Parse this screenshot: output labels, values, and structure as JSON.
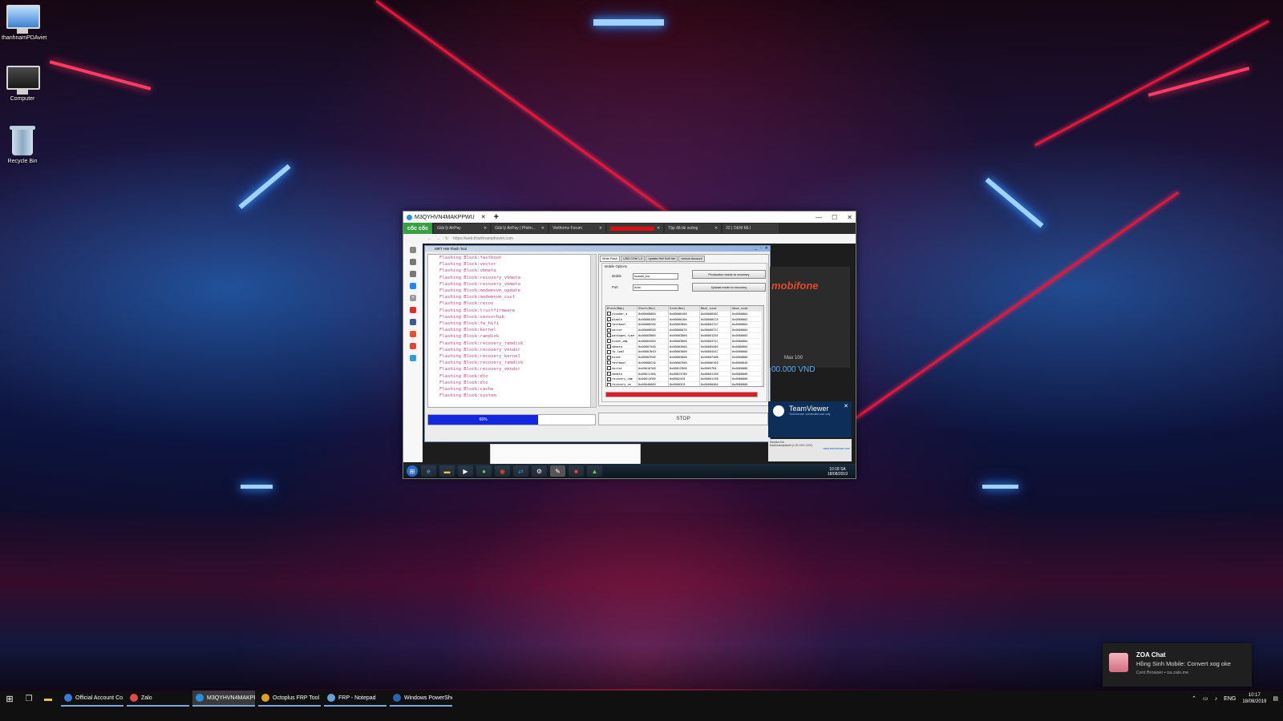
{
  "desktop": {
    "icons": [
      {
        "label": "thanhnamPDAviet"
      },
      {
        "label": "Computer"
      },
      {
        "label": "Recycle Bin"
      }
    ]
  },
  "remote_window": {
    "tab_title": "M3QYHVN4MAKPPWU",
    "tab_close": "✕",
    "new_tab": "+",
    "browser": {
      "brand": "cốc cốc",
      "tabs": [
        {
          "label": "Giải lý AirPay"
        },
        {
          "label": "Giải lý AirPay | Phiên..."
        },
        {
          "label": "Vietforms Forum"
        },
        {
          "label": ""
        },
        {
          "label": "Tập đã tải xuống"
        },
        {
          "label": "22 | OEM MLI"
        }
      ],
      "address": "https://web.thanhnamphoviet.com"
    },
    "mrt": {
      "title": "MRT HW Flash Tool",
      "log_lines": [
        "Flashing Block:fastboot",
        "Flashing Block:vector",
        "Flashing Block:vbmeta",
        "Flashing Block:recovery_vbmeta",
        "Flashing Block:recovery_vbmeta",
        "Flashing Block:modemnvm_update",
        "Flashing Block:modemnvm_cust",
        "Flashing Block:recov",
        "Flashing Block:trustfirmware",
        "Flashing Block:sensorhub",
        "Flashing Block:fw_hifi",
        "Flashing Block:kernel",
        "Flashing Block:ramdisk",
        "Flashing Block:recovery_ramdisk",
        "Flashing Block:recovery_vendor",
        "Flashing Block:recovery_kernel",
        "Flashing Block:recovery_ramdisk",
        "Flashing Block:recovery_vendor",
        "Flashing Block:dto",
        "Flashing Block:dto",
        "Flashing Block:cache",
        "Flashing Block:system"
      ],
      "panel_tabs": [
        "Write Flash",
        "USB COM 1.0",
        "Update HW Soft Ver",
        "Unlock Account"
      ],
      "group_title": "Mobile Options",
      "mobile_label": "Mobile",
      "mobile_value": "huawei_fus",
      "port_label": "Port",
      "port_value": "Auto",
      "btn_production": "Production mode to recovery",
      "btn_upload": "Upload mode to recovery",
      "grid_headers": [
        "Block(Map)",
        "Start(Hex)",
        "Size(Hex)",
        "Real_size",
        "Save_size"
      ],
      "grid_rows": [
        [
          "xloader_a",
          "0x00000000",
          "0x00000100",
          "0x0000030C",
          "0x0000004"
        ],
        [
          "ptable",
          "0x00000100",
          "0x0000010A",
          "0x00000CC0",
          "0x0000002"
        ],
        [
          "fastboot",
          "0x00000C00",
          "0x0000300A",
          "0x0000472C",
          "0x0000004"
        ],
        [
          "vector",
          "0x00000E00",
          "0x00000070",
          "0x0000072C",
          "0x0000004"
        ],
        [
          "packages_type",
          "0x00003800",
          "0x00003800",
          "0x0000125E",
          "0x0000004"
        ],
        [
          "hisee_img",
          "0x00004500",
          "0x00003000",
          "0x0000472C",
          "0x0000004"
        ],
        [
          "vbmeta",
          "0x00007540",
          "0x00003000",
          "0x0000540E",
          "0x0000004"
        ],
        [
          "fw_lpm3",
          "0x00007840",
          "0x00003000",
          "0x0000454C",
          "0x000000A"
        ],
        [
          "hisee",
          "0x00007E00",
          "0x00003000",
          "0x0000740B",
          "0x0000000"
        ],
        [
          "fastboot",
          "0x00008C40",
          "0x0000C900",
          "0x00006760",
          "0x0000040"
        ],
        [
          "vector",
          "0x00010700",
          "0x00012900",
          "0x00057E0",
          "0x0000080"
        ],
        [
          "vbmeta",
          "0x00011100",
          "0x00023700",
          "0x0000115B",
          "0x0000000"
        ],
        [
          "recovery_vbm",
          "0x00011F80",
          "0x00024C0",
          "0x0000115B",
          "0x0000000"
        ],
        [
          "recovery_vb",
          "0x00040A00",
          "0x00003C0",
          "0x0000040A",
          "0x0000000"
        ]
      ],
      "progress_label": "66%",
      "progress_value": 0.66,
      "red_progress": 1.0,
      "stop_label": "STOP"
    },
    "side": {
      "mobifone": "mobifone",
      "max": "Max 100",
      "price": "00.000 VND"
    },
    "teamviewer": {
      "title": "TeamViewer",
      "subtitle": "Trial license: connection use only",
      "list_header": "Session list",
      "list_item": "thanhnampdaviet (1 ID-XXX-XXX)",
      "link": "www.teamviewer.com"
    },
    "remote_clock": {
      "time": "10:18 SA",
      "date": "18/08/2019"
    }
  },
  "notification": {
    "app": "ZOA Chat",
    "message": "Hồng Sinh Mobile: Convert xog oke",
    "source": "Cent Browser • oa.zalo.me"
  },
  "taskbar": {
    "apps": [
      {
        "label": "Official Account Co...",
        "color": "#3b7bd6"
      },
      {
        "label": "Zalo",
        "color": "#e24a4a"
      },
      {
        "label": "M3QYHVN4MAKPP...",
        "color": "#2b8fe0"
      },
      {
        "label": "Octoplus FRP Tool v...",
        "color": "#e0a020"
      },
      {
        "label": "FRP - Notepad",
        "color": "#6aa0d8"
      },
      {
        "label": "Windows PowerShell",
        "color": "#3060b0"
      }
    ],
    "lang": "ENG",
    "time": "10:17",
    "date": "18/08/2019"
  }
}
